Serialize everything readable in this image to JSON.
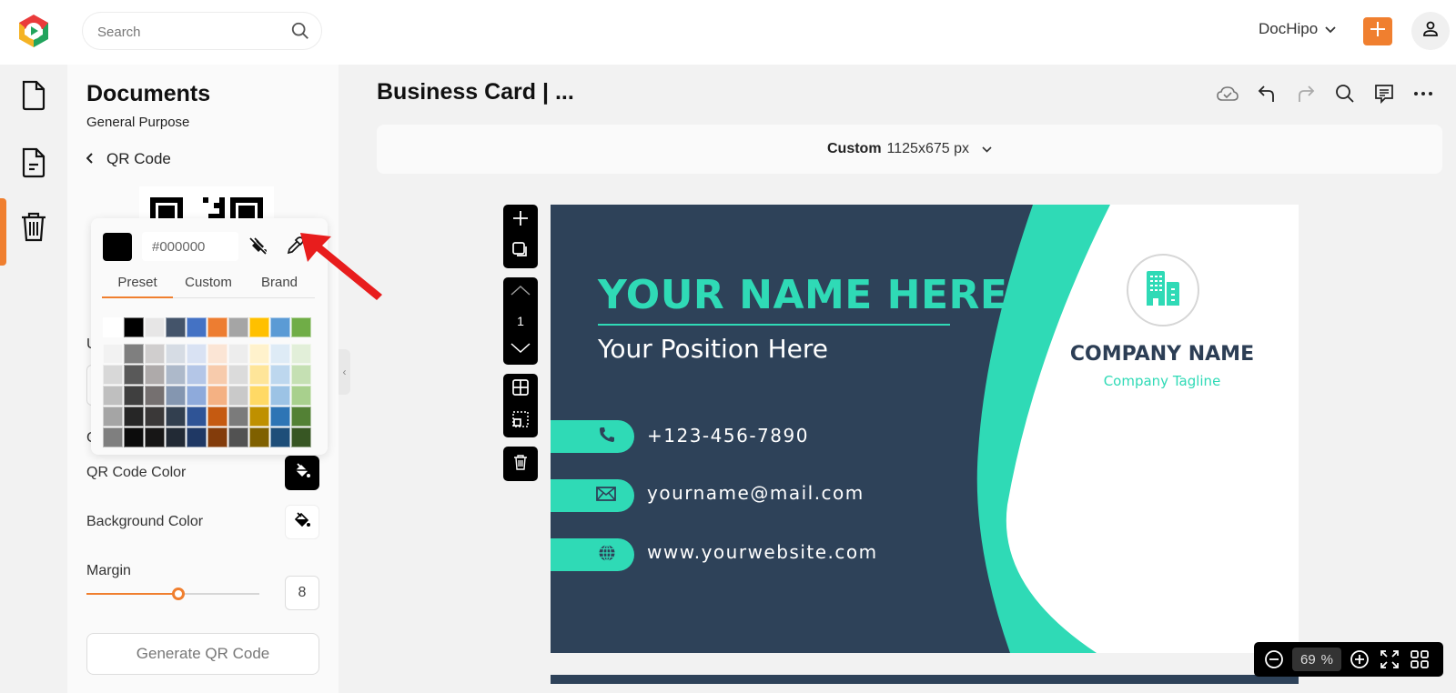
{
  "header": {
    "search_placeholder": "Search",
    "workspace": "DocHipo",
    "brand_colors": {
      "accent": "#f07f2f"
    }
  },
  "sidebar_rail": {
    "items": [
      {
        "name": "documents",
        "icon": "document-icon"
      },
      {
        "name": "my-documents",
        "icon": "document-lines-icon",
        "active": true
      },
      {
        "name": "trash",
        "icon": "trash-icon"
      }
    ]
  },
  "panel": {
    "title": "Documents",
    "subtitle": "General Purpose",
    "back_label": "QR Code",
    "hidden_label_1": "U",
    "hidden_label_2": "C",
    "qr_code_color_label": "QR Code Color",
    "qr_code_color": "#000000",
    "background_color_label": "Background Color",
    "background_color": "#ffffff",
    "margin_label": "Margin",
    "margin_value": "8",
    "margin_fraction": 0.53,
    "generate_button": "Generate QR Code"
  },
  "color_picker": {
    "hex_value": "#000000",
    "tabs": [
      "Preset",
      "Custom",
      "Brand"
    ],
    "active_tab": "Preset",
    "base_colors": [
      "#ffffff",
      "#000000",
      "#e7e6e6",
      "#44546a",
      "#4472c4",
      "#ed7d31",
      "#a5a5a5",
      "#ffc000",
      "#5b9bd5",
      "#70ad47"
    ],
    "shades": [
      [
        "#f2f2f2",
        "#7f7f7f",
        "#d0cece",
        "#d6dce4",
        "#d9e2f3",
        "#fbe5d5",
        "#ededed",
        "#fff2cc",
        "#deebf6",
        "#e2efd9"
      ],
      [
        "#d8d8d8",
        "#595959",
        "#aeaaaa",
        "#adb9ca",
        "#b4c6e7",
        "#f7cbac",
        "#dbdbdb",
        "#fee599",
        "#bdd7ee",
        "#c5e0b3"
      ],
      [
        "#bfbfbf",
        "#3f3f3f",
        "#757070",
        "#8496b0",
        "#8eaadb",
        "#f4b183",
        "#c9c9c9",
        "#ffd965",
        "#9cc3e5",
        "#a8d08d"
      ],
      [
        "#a5a5a5",
        "#262626",
        "#3a3838",
        "#323f4f",
        "#2f5496",
        "#c55a11",
        "#7b7b7b",
        "#bf9000",
        "#2e75b5",
        "#538135"
      ],
      [
        "#7f7f7f",
        "#0c0c0c",
        "#171616",
        "#222a35",
        "#1f3864",
        "#833c0b",
        "#525252",
        "#7f6000",
        "#1e4e79",
        "#375623"
      ]
    ]
  },
  "editor": {
    "doc_title": "Business Card | ...",
    "size_preset": "Custom",
    "size_dims": "1125x675 px",
    "page_number": "1",
    "zoom_value": "69",
    "zoom_unit": "%"
  },
  "card": {
    "name": "YOUR NAME HERE",
    "position": "Your Position Here",
    "phone": "+123-456-7890",
    "email": "yourname@mail.com",
    "website": "www.yourwebsite.com",
    "company": "COMPANY NAME",
    "tagline": "Company Tagline",
    "colors": {
      "navy": "#2e4259",
      "teal": "#2fdab6",
      "white": "#ffffff"
    }
  }
}
